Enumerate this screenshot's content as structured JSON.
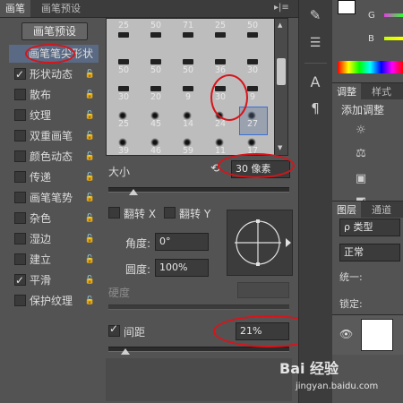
{
  "tabs": {
    "brush": "画笔",
    "brush_presets": "画笔预设",
    "menu_glyph": "▸|≡"
  },
  "preset_button": "画笔预设",
  "options": [
    {
      "label": "画笔笔尖形状",
      "checkbox": false,
      "checked": false,
      "lock": false,
      "active": true
    },
    {
      "label": "形状动态",
      "checkbox": true,
      "checked": true,
      "lock": true
    },
    {
      "label": "散布",
      "checkbox": true,
      "checked": false,
      "lock": true
    },
    {
      "label": "纹理",
      "checkbox": true,
      "checked": false,
      "lock": true
    },
    {
      "label": "双重画笔",
      "checkbox": true,
      "checked": false,
      "lock": true
    },
    {
      "label": "颜色动态",
      "checkbox": true,
      "checked": false,
      "lock": true
    },
    {
      "label": "传递",
      "checkbox": true,
      "checked": false,
      "lock": true
    },
    {
      "label": "画笔笔势",
      "checkbox": true,
      "checked": false,
      "lock": true
    },
    {
      "label": "杂色",
      "checkbox": true,
      "checked": false,
      "lock": true
    },
    {
      "label": "湿边",
      "checkbox": true,
      "checked": false,
      "lock": true
    },
    {
      "label": "建立",
      "checkbox": true,
      "checked": false,
      "lock": true
    },
    {
      "label": "平滑",
      "checkbox": true,
      "checked": true,
      "lock": true
    },
    {
      "label": "保护纹理",
      "checkbox": true,
      "checked": false,
      "lock": true
    }
  ],
  "brush_grid": {
    "rows": [
      [
        "25",
        "50",
        "71",
        "25",
        "50"
      ],
      [
        "50",
        "50",
        "50",
        "36",
        "30"
      ],
      [
        "30",
        "20",
        "9",
        "30",
        "9"
      ],
      [
        "25",
        "45",
        "14",
        "24",
        "27"
      ],
      [
        "39",
        "46",
        "59",
        "11",
        "17"
      ]
    ],
    "selected": "27"
  },
  "size": {
    "label": "大小",
    "value": "30 像素",
    "reset_icon": "reset-icon"
  },
  "flip_x": {
    "label": "翻转 X",
    "checked": false
  },
  "flip_y": {
    "label": "翻转 Y",
    "checked": false
  },
  "angle": {
    "label": "角度:",
    "value": "0°"
  },
  "roundness": {
    "label": "圆度:",
    "value": "100%"
  },
  "hardness": {
    "label": "硬度",
    "value": ""
  },
  "spacing": {
    "label": "间距",
    "value": "21%",
    "checked": true
  },
  "color_panel": {
    "g": "G",
    "b": "B"
  },
  "adjust_panel": {
    "tab_adjust": "调整",
    "tab_style": "样式",
    "add_adjust": "添加调整"
  },
  "layers_panel": {
    "tab_layers": "图层",
    "tab_channels": "通道",
    "kind": "ρ 类型",
    "mode": "正常",
    "unify": "统一:",
    "lock": "锁定:"
  },
  "watermark": {
    "site": "jingyan.baidu.com",
    "brand": "Bai 经验"
  },
  "colors": {
    "panel": "#535353",
    "dark": "#3c3c3c",
    "selection": "#5a6a84",
    "annotation": "#d8141a"
  }
}
